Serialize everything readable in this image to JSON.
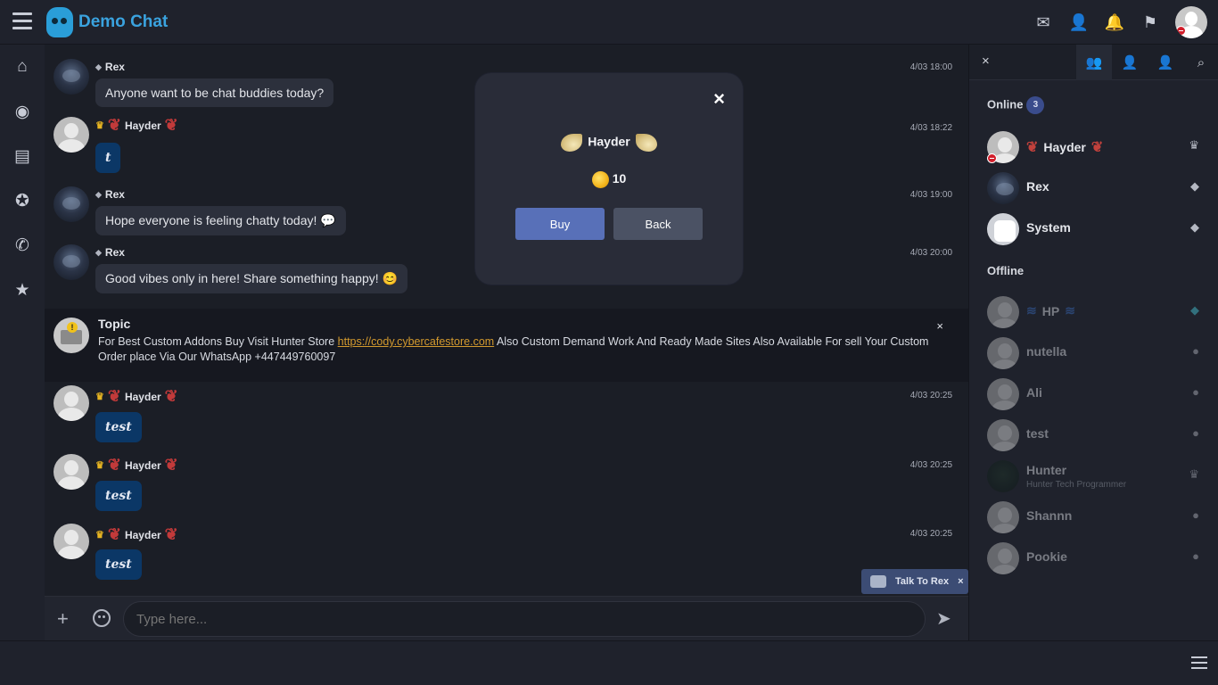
{
  "app": {
    "title": "Demo Chat"
  },
  "colors": {
    "accent": "#3aa3df",
    "buy": "#5870b8",
    "danger": "#d21e2b"
  },
  "topbar": {
    "icons": [
      "menu-icon",
      "envelope-icon",
      "add-user-icon",
      "bell-icon",
      "flag-icon"
    ]
  },
  "leftnav": {
    "icons": [
      "home-icon",
      "rss-icon",
      "news-icon",
      "medal-icon",
      "phone-icon",
      "star-icon"
    ]
  },
  "messages": [
    {
      "user": "Rex",
      "time": "4/03 18:00",
      "text": "Anyone want to be chat buddies today?"
    },
    {
      "user": "Hayder",
      "time": "4/03 18:22",
      "text": "t"
    },
    {
      "user": "Rex",
      "time": "4/03 19:00",
      "text": "Hope everyone is feeling chatty today! 💬"
    },
    {
      "user": "Rex",
      "time": "4/03 20:00",
      "text": "Good vibes only in here! Share something happy! 😊"
    },
    {
      "user": "Hayder",
      "time": "4/03 20:25",
      "text": "test"
    },
    {
      "user": "Hayder",
      "time": "4/03 20:25",
      "text": "test"
    },
    {
      "user": "Hayder",
      "time": "4/03 20:25",
      "text": "test"
    }
  ],
  "topic": {
    "title": "Topic",
    "text_before": "For Best Custom Addons Buy Visit Hunter Store ",
    "link": "https://cody.cybercafestore.com",
    "text_after": " Also Custom Demand Work And Ready Made Sites Also Available For sell Your Custom Order place Via Our WhatsApp +447449760097",
    "close": "×"
  },
  "talk_to_rex": {
    "label": "Talk To Rex",
    "close": "×"
  },
  "input": {
    "placeholder": "Type here..."
  },
  "userpanel": {
    "close": "×",
    "online_label": "Online",
    "online_count": "3",
    "offline_label": "Offline",
    "online": [
      {
        "name": "Hayder",
        "icon": "crown-icon"
      },
      {
        "name": "Rex",
        "icon": "robot-icon"
      },
      {
        "name": "System",
        "icon": "robot-icon"
      }
    ],
    "offline": [
      {
        "name": "HP",
        "icon": "diamond-icon"
      },
      {
        "name": "nutella",
        "icon": "user-icon"
      },
      {
        "name": "Ali",
        "icon": "user-icon"
      },
      {
        "name": "test",
        "icon": "user-icon"
      },
      {
        "name": "Hunter",
        "subtitle": "Hunter Tech Programmer",
        "icon": "crown-icon"
      },
      {
        "name": "Shannn",
        "icon": "user-icon"
      },
      {
        "name": "Pookie",
        "icon": "user-icon"
      }
    ]
  },
  "modal": {
    "close": "×",
    "name": "Hayder",
    "price": "10",
    "buy_label": "Buy",
    "back_label": "Back"
  }
}
